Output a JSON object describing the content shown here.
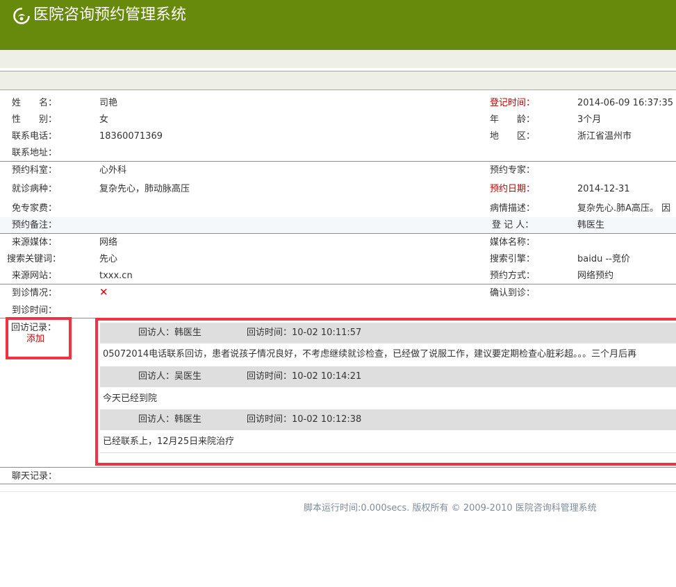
{
  "app": {
    "title": "医院咨询预约管理系统"
  },
  "patient": {
    "name_label": "姓　　名：",
    "name": "司艳",
    "gender_label": "性　　别：",
    "gender": "女",
    "phone_label": "联系电话：",
    "phone": "18360071369",
    "address_label": "联系地址：",
    "address": "",
    "reg_time_label": "登记时间：",
    "reg_time": "2014-06-09 16:37:35",
    "age_label": "年　　龄：",
    "age": "3个月",
    "region_label": "地　　区：",
    "region": "浙江省温州市"
  },
  "appointment": {
    "dept_label": "预约科室：",
    "dept": "心外科",
    "disease_label": "就诊病种：",
    "disease": "复杂先心，肺动脉高压",
    "fee_label": "免专家费：",
    "fee": "",
    "remark_label": "预约备注：",
    "remark": "",
    "expert_label": "预约专家：",
    "expert": "",
    "date_label": "预约日期：",
    "date": "2014-12-31",
    "desc_label": "病情描述：",
    "desc": "复杂先心.肺A高压。 因",
    "registrar_label": "登 记 人：",
    "registrar": "韩医生"
  },
  "source": {
    "media_label": "来源媒体：",
    "media": "网络",
    "keyword_label": "搜索关键词：",
    "keyword": "先心",
    "site_label": "来源网站：",
    "site": "txxx.cn",
    "media_name_label": "媒体名称：",
    "media_name": "",
    "engine_label": "搜索引擎：",
    "engine": "baidu --竞价",
    "method_label": "预约方式：",
    "method": "网络预约"
  },
  "visit": {
    "status_label": "到诊情况：",
    "status_icon": "cross-mark-icon",
    "status_mark": "✕",
    "time_label": "到诊时间：",
    "time": "",
    "confirm_label": "确认到诊：",
    "confirm": ""
  },
  "followups": {
    "label": "回访记录：",
    "add_label": "添加",
    "records": [
      {
        "visitor": "回访人：韩医生",
        "time": "回访时间：10-02 10:11:57",
        "content": "05072014电话联系回访，患者说孩子情况良好，不考虑继续就诊检查，已经做了说服工作，建议要定期检查心脏彩超。。。三个月后再"
      },
      {
        "visitor": "回访人：吴医生",
        "time": "回访时间：10-02 10:14:21",
        "content": "今天已经到院"
      },
      {
        "visitor": "回访人：韩医生",
        "time": "回访时间：10-02 10:12:38",
        "content": "已经联系上，12月25日来院治疗"
      }
    ]
  },
  "chat": {
    "label": "聊天记录："
  },
  "footer": {
    "text": "脚本运行时间:0.000secs. 版权所有 © 2009-2010 医院咨询科管理系统"
  },
  "colors": {
    "header": "#678a0c",
    "highlight_frame": "#ef3340",
    "accent_red": "#c00000"
  }
}
